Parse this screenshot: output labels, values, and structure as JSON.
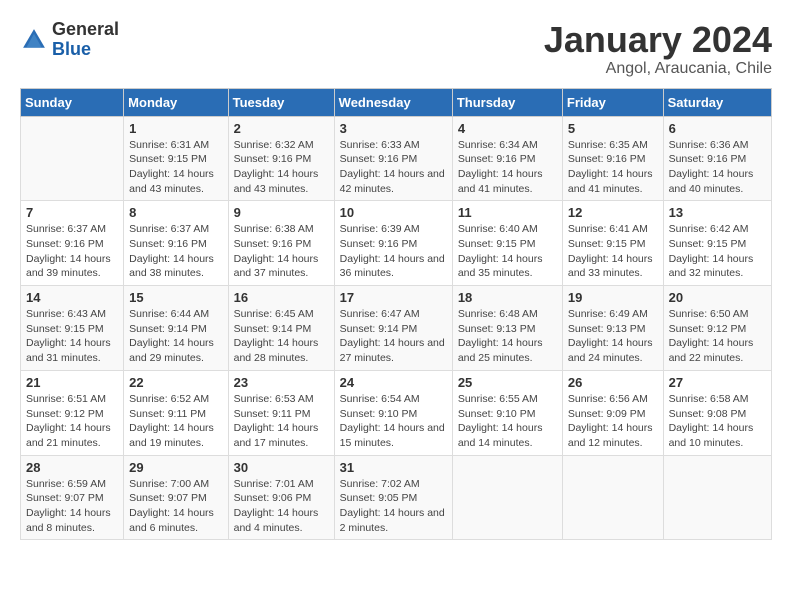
{
  "header": {
    "logo_general": "General",
    "logo_blue": "Blue",
    "title": "January 2024",
    "subtitle": "Angol, Araucania, Chile"
  },
  "calendar": {
    "days_of_week": [
      "Sunday",
      "Monday",
      "Tuesday",
      "Wednesday",
      "Thursday",
      "Friday",
      "Saturday"
    ],
    "weeks": [
      [
        {
          "day": "",
          "sunrise": "",
          "sunset": "",
          "daylight": ""
        },
        {
          "day": "1",
          "sunrise": "Sunrise: 6:31 AM",
          "sunset": "Sunset: 9:15 PM",
          "daylight": "Daylight: 14 hours and 43 minutes."
        },
        {
          "day": "2",
          "sunrise": "Sunrise: 6:32 AM",
          "sunset": "Sunset: 9:16 PM",
          "daylight": "Daylight: 14 hours and 43 minutes."
        },
        {
          "day": "3",
          "sunrise": "Sunrise: 6:33 AM",
          "sunset": "Sunset: 9:16 PM",
          "daylight": "Daylight: 14 hours and 42 minutes."
        },
        {
          "day": "4",
          "sunrise": "Sunrise: 6:34 AM",
          "sunset": "Sunset: 9:16 PM",
          "daylight": "Daylight: 14 hours and 41 minutes."
        },
        {
          "day": "5",
          "sunrise": "Sunrise: 6:35 AM",
          "sunset": "Sunset: 9:16 PM",
          "daylight": "Daylight: 14 hours and 41 minutes."
        },
        {
          "day": "6",
          "sunrise": "Sunrise: 6:36 AM",
          "sunset": "Sunset: 9:16 PM",
          "daylight": "Daylight: 14 hours and 40 minutes."
        }
      ],
      [
        {
          "day": "7",
          "sunrise": "Sunrise: 6:37 AM",
          "sunset": "Sunset: 9:16 PM",
          "daylight": "Daylight: 14 hours and 39 minutes."
        },
        {
          "day": "8",
          "sunrise": "Sunrise: 6:37 AM",
          "sunset": "Sunset: 9:16 PM",
          "daylight": "Daylight: 14 hours and 38 minutes."
        },
        {
          "day": "9",
          "sunrise": "Sunrise: 6:38 AM",
          "sunset": "Sunset: 9:16 PM",
          "daylight": "Daylight: 14 hours and 37 minutes."
        },
        {
          "day": "10",
          "sunrise": "Sunrise: 6:39 AM",
          "sunset": "Sunset: 9:16 PM",
          "daylight": "Daylight: 14 hours and 36 minutes."
        },
        {
          "day": "11",
          "sunrise": "Sunrise: 6:40 AM",
          "sunset": "Sunset: 9:15 PM",
          "daylight": "Daylight: 14 hours and 35 minutes."
        },
        {
          "day": "12",
          "sunrise": "Sunrise: 6:41 AM",
          "sunset": "Sunset: 9:15 PM",
          "daylight": "Daylight: 14 hours and 33 minutes."
        },
        {
          "day": "13",
          "sunrise": "Sunrise: 6:42 AM",
          "sunset": "Sunset: 9:15 PM",
          "daylight": "Daylight: 14 hours and 32 minutes."
        }
      ],
      [
        {
          "day": "14",
          "sunrise": "Sunrise: 6:43 AM",
          "sunset": "Sunset: 9:15 PM",
          "daylight": "Daylight: 14 hours and 31 minutes."
        },
        {
          "day": "15",
          "sunrise": "Sunrise: 6:44 AM",
          "sunset": "Sunset: 9:14 PM",
          "daylight": "Daylight: 14 hours and 29 minutes."
        },
        {
          "day": "16",
          "sunrise": "Sunrise: 6:45 AM",
          "sunset": "Sunset: 9:14 PM",
          "daylight": "Daylight: 14 hours and 28 minutes."
        },
        {
          "day": "17",
          "sunrise": "Sunrise: 6:47 AM",
          "sunset": "Sunset: 9:14 PM",
          "daylight": "Daylight: 14 hours and 27 minutes."
        },
        {
          "day": "18",
          "sunrise": "Sunrise: 6:48 AM",
          "sunset": "Sunset: 9:13 PM",
          "daylight": "Daylight: 14 hours and 25 minutes."
        },
        {
          "day": "19",
          "sunrise": "Sunrise: 6:49 AM",
          "sunset": "Sunset: 9:13 PM",
          "daylight": "Daylight: 14 hours and 24 minutes."
        },
        {
          "day": "20",
          "sunrise": "Sunrise: 6:50 AM",
          "sunset": "Sunset: 9:12 PM",
          "daylight": "Daylight: 14 hours and 22 minutes."
        }
      ],
      [
        {
          "day": "21",
          "sunrise": "Sunrise: 6:51 AM",
          "sunset": "Sunset: 9:12 PM",
          "daylight": "Daylight: 14 hours and 21 minutes."
        },
        {
          "day": "22",
          "sunrise": "Sunrise: 6:52 AM",
          "sunset": "Sunset: 9:11 PM",
          "daylight": "Daylight: 14 hours and 19 minutes."
        },
        {
          "day": "23",
          "sunrise": "Sunrise: 6:53 AM",
          "sunset": "Sunset: 9:11 PM",
          "daylight": "Daylight: 14 hours and 17 minutes."
        },
        {
          "day": "24",
          "sunrise": "Sunrise: 6:54 AM",
          "sunset": "Sunset: 9:10 PM",
          "daylight": "Daylight: 14 hours and 15 minutes."
        },
        {
          "day": "25",
          "sunrise": "Sunrise: 6:55 AM",
          "sunset": "Sunset: 9:10 PM",
          "daylight": "Daylight: 14 hours and 14 minutes."
        },
        {
          "day": "26",
          "sunrise": "Sunrise: 6:56 AM",
          "sunset": "Sunset: 9:09 PM",
          "daylight": "Daylight: 14 hours and 12 minutes."
        },
        {
          "day": "27",
          "sunrise": "Sunrise: 6:58 AM",
          "sunset": "Sunset: 9:08 PM",
          "daylight": "Daylight: 14 hours and 10 minutes."
        }
      ],
      [
        {
          "day": "28",
          "sunrise": "Sunrise: 6:59 AM",
          "sunset": "Sunset: 9:07 PM",
          "daylight": "Daylight: 14 hours and 8 minutes."
        },
        {
          "day": "29",
          "sunrise": "Sunrise: 7:00 AM",
          "sunset": "Sunset: 9:07 PM",
          "daylight": "Daylight: 14 hours and 6 minutes."
        },
        {
          "day": "30",
          "sunrise": "Sunrise: 7:01 AM",
          "sunset": "Sunset: 9:06 PM",
          "daylight": "Daylight: 14 hours and 4 minutes."
        },
        {
          "day": "31",
          "sunrise": "Sunrise: 7:02 AM",
          "sunset": "Sunset: 9:05 PM",
          "daylight": "Daylight: 14 hours and 2 minutes."
        },
        {
          "day": "",
          "sunrise": "",
          "sunset": "",
          "daylight": ""
        },
        {
          "day": "",
          "sunrise": "",
          "sunset": "",
          "daylight": ""
        },
        {
          "day": "",
          "sunrise": "",
          "sunset": "",
          "daylight": ""
        }
      ]
    ]
  }
}
